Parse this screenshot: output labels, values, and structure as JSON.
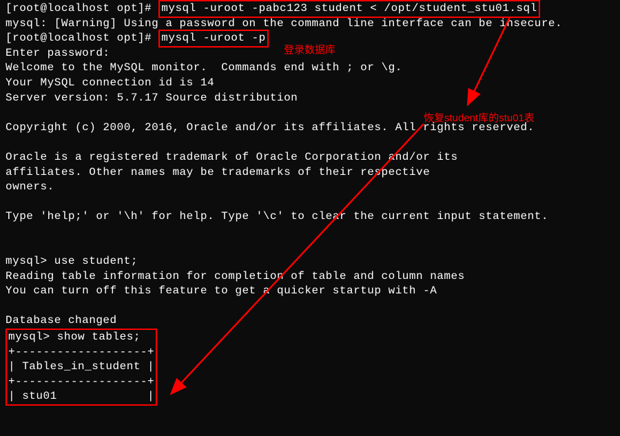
{
  "lines": {
    "p1_prompt": "[root@localhost opt]# ",
    "p1_cmd": "mysql -uroot -pabc123 student < /opt/student_stu01.sql",
    "warn": "mysql: [Warning] Using a password on the command line interface can be insecure.",
    "p2_prompt": "[root@localhost opt]# ",
    "p2_cmd": "mysql -uroot -p",
    "enterpw": "Enter password:",
    "welcome": "Welcome to the MySQL monitor.  Commands end with ; or \\g.",
    "connid": "Your MySQL connection id is 14",
    "srvver": "Server version: 5.7.17 Source distribution",
    "copyright": "Copyright (c) 2000, 2016, Oracle and/or its affiliates. All rights reserved.",
    "trade1": "Oracle is a registered trademark of Oracle Corporation and/or its",
    "trade2": "affiliates. Other names may be trademarks of their respective",
    "trade3": "owners.",
    "help": "Type 'help;' or '\\h' for help. Type '\\c' to clear the current input statement.",
    "m1_prompt": "mysql> ",
    "m1_cmd": "use student;",
    "reading": "Reading table information for completion of table and column names",
    "turnoff": "You can turn off this feature to get a quicker startup with -A",
    "dbchanged": "Database changed",
    "m2_prompt": "mysql> ",
    "m2_cmd": "show tables;",
    "tb_border": "+-------------------+",
    "tb_header": "| Tables_in_student |",
    "tb_row1": "| stu01             |"
  },
  "annotations": {
    "login": "登录数据库",
    "restore": "恢复student库的stu01表"
  },
  "colors": {
    "bg": "#0c0c0c",
    "fg": "#ffffff",
    "highlight": "#ff0000"
  }
}
